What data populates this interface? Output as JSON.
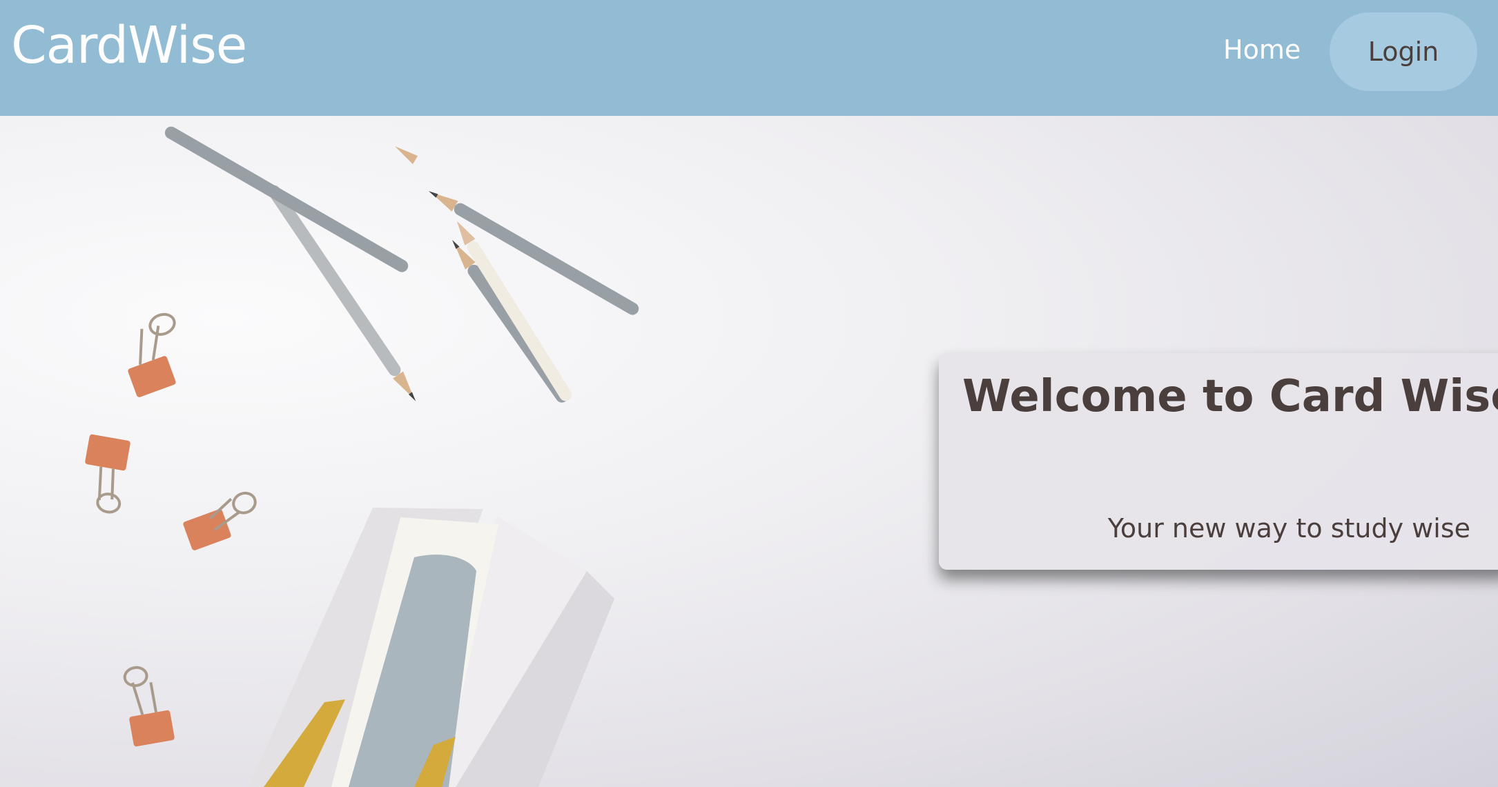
{
  "navbar": {
    "brand": "CardWise",
    "links": {
      "home": "Home",
      "login": "Login"
    },
    "bg_color": "#92bbd4"
  },
  "hero": {
    "title": "Welcome to Card Wise!",
    "subtitle": "Your new way to study wise",
    "text_color": "#4a3f3d",
    "background": "flat-lay desk photo with pencils, binder clips and paper cards"
  }
}
